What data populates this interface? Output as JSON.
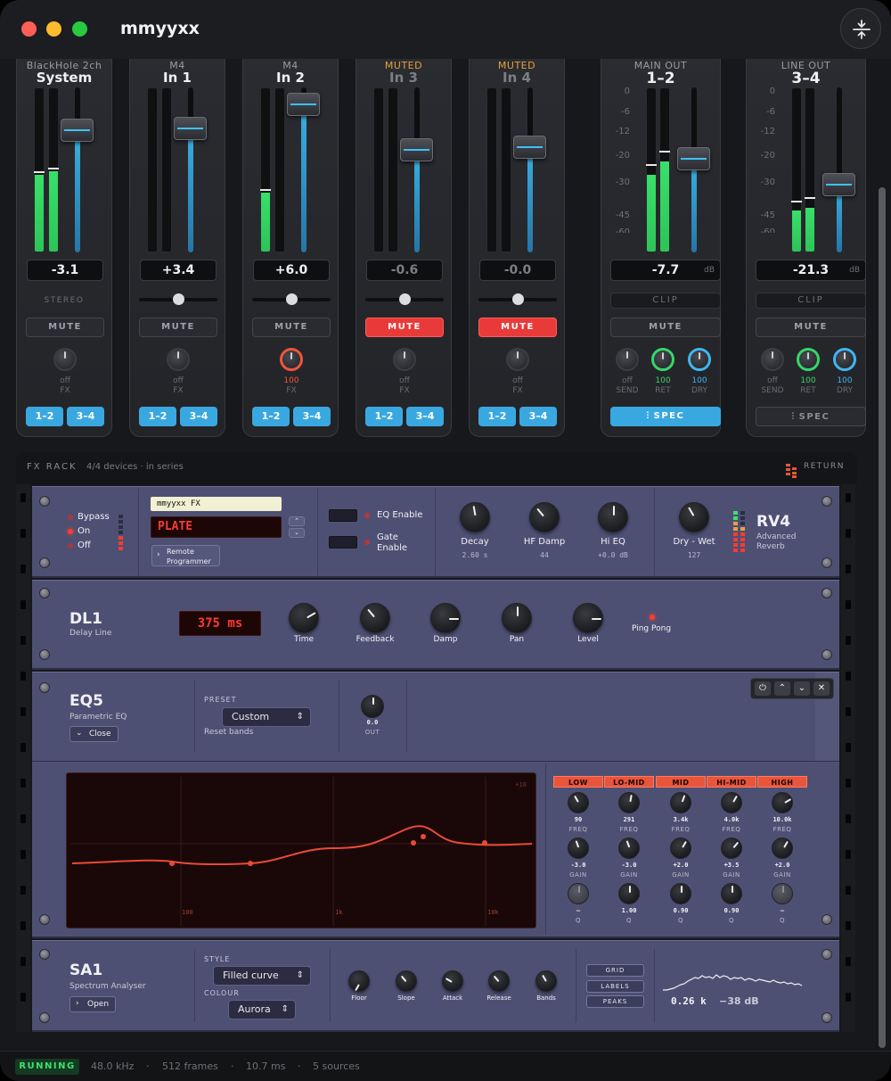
{
  "app": {
    "title": "mmyyxx"
  },
  "colors": {
    "accent": "#3aa8e0",
    "mute_active": "#e93a3a",
    "meter_green": "#36d668",
    "lcd_red": "#ff3b30",
    "rack_panel": "#4e5073"
  },
  "icons": {
    "titlebar_button": "collapse-vertical-icon",
    "fx_rack": "meter-bars-icon",
    "screw": "rack-screw-icon",
    "spec": "waveform-icon"
  },
  "mixer": {
    "strips": [
      {
        "sub": "BlackHole 2ch",
        "name": "System",
        "readout": "-3.1",
        "label": "STEREO",
        "mute": "MUTE",
        "fx_val": "off",
        "fx_lbl": "FX",
        "r1": "1–2",
        "r2": "3–4",
        "meter_left": 0.47,
        "meter_right": 0.49,
        "fader": 0.74,
        "pan": 0.5,
        "muted": false
      },
      {
        "sub": "M4",
        "name": "In 1",
        "readout": "+3.4",
        "mute": "MUTE",
        "fx_val": "off",
        "fx_lbl": "FX",
        "r1": "1–2",
        "r2": "3–4",
        "meter_left": 0,
        "meter_right": 0,
        "fader": 0.75,
        "pan": 0.5,
        "muted": false
      },
      {
        "sub": "M4",
        "name": "In 2",
        "readout": "+6.0",
        "mute": "MUTE",
        "fx_val": "100",
        "fx_lbl": "FX",
        "r1": "1–2",
        "r2": "3–4",
        "meter_left": 0.36,
        "meter_right": 0,
        "fader": 0.9,
        "pan": 0.5,
        "muted": false
      },
      {
        "sub": "MUTED",
        "name": "In 3",
        "readout": "-0.6",
        "mute": "MUTE",
        "fx_val": "off",
        "fx_lbl": "FX",
        "r1": "1–2",
        "r2": "3–4",
        "meter_left": 0,
        "meter_right": 0,
        "fader": 0.62,
        "pan": 0.5,
        "muted": true
      },
      {
        "sub": "MUTED",
        "name": "In 4",
        "readout": "-0.0",
        "mute": "MUTE",
        "fx_val": "off",
        "fx_lbl": "FX",
        "r1": "1–2",
        "r2": "3–4",
        "meter_left": 0,
        "meter_right": 0,
        "fader": 0.64,
        "pan": 0.5,
        "muted": true
      }
    ],
    "outs": [
      {
        "sub": "MAIN OUT",
        "name": "1–2",
        "readout": "-7.7",
        "unit": "dB",
        "clip": "CLIP",
        "mute": "MUTE",
        "send_val": "off",
        "send_lbl": "SEND",
        "ret_val": "100",
        "ret_lbl": "RET",
        "dry_val": "100",
        "dry_lbl": "DRY",
        "spec": "SPEC",
        "meter_left": 0.47,
        "meter_right": 0.55,
        "fader": 0.57,
        "spec_active": true
      },
      {
        "sub": "LINE OUT",
        "name": "3–4",
        "readout": "-21.3",
        "unit": "dB",
        "clip": "CLIP",
        "mute": "MUTE",
        "send_val": "off",
        "send_lbl": "SEND",
        "ret_val": "100",
        "ret_lbl": "RET",
        "dry_val": "100",
        "dry_lbl": "DRY",
        "spec": "SPEC",
        "meter_left": 0.25,
        "meter_right": 0.27,
        "fader": 0.41,
        "spec_active": false
      }
    ],
    "scale_ticks": [
      "0",
      "-6",
      "-12",
      "-20",
      "-30",
      "-45",
      "-60"
    ]
  },
  "rack": {
    "title": "FX RACK",
    "info": "4/4 devices · in series",
    "return": "RETURN",
    "rv4": {
      "bypass": "Bypass",
      "on": "On",
      "off": "Off",
      "preset_name": "mmyyxx FX",
      "preset": "PLATE",
      "remote": "Remote Programmer",
      "eq_enable": "EQ Enable",
      "gate_enable": "Gate Enable",
      "knobs": [
        {
          "label": "Decay",
          "value": "2.60 s"
        },
        {
          "label": "HF Damp",
          "value": "44"
        },
        {
          "label": "Hi EQ",
          "value": "+0.0 dB"
        },
        {
          "label": "Dry - Wet",
          "value": "127"
        }
      ],
      "name": "RV4",
      "sub": "Advanced Reverb"
    },
    "dl1": {
      "name": "DL1",
      "sub": "Delay Line",
      "time": "375 ms",
      "knobs": [
        "Time",
        "Feedback",
        "Damp",
        "Pan",
        "Level"
      ],
      "ping": "Ping Pong"
    },
    "eq5": {
      "name": "EQ5",
      "sub": "Parametric EQ",
      "close": "Close",
      "preset_lbl": "PRESET",
      "preset": "Custom",
      "reset": "Reset bands",
      "out_val": "0.0",
      "out_lbl": "OUT",
      "grid_top": "+18",
      "xticks": [
        "100",
        "1k",
        "10k"
      ],
      "bands": [
        {
          "name": "LOW",
          "freq": "90",
          "gain": "-3.0",
          "q": "–"
        },
        {
          "name": "LO-MID",
          "freq": "291",
          "gain": "-3.0",
          "q": "1.00"
        },
        {
          "name": "MID",
          "freq": "3.4k",
          "gain": "+2.0",
          "q": "0.90"
        },
        {
          "name": "HI-MID",
          "freq": "4.0k",
          "gain": "+3.5",
          "q": "0.90"
        },
        {
          "name": "HIGH",
          "freq": "10.0k",
          "gain": "+2.0",
          "q": "–"
        }
      ],
      "freq_lbl": "FREQ",
      "gain_lbl": "GAIN",
      "q_lbl": "Q"
    },
    "sa1": {
      "name": "SA1",
      "sub": "Spectrum Analyser",
      "open": "Open",
      "style_lbl": "STYLE",
      "style": "Filled curve",
      "colour_lbl": "COLOUR",
      "colour": "Aurora",
      "knobs": [
        "Floor",
        "Slope",
        "Attack",
        "Release",
        "Bands"
      ],
      "toggles": [
        "GRID",
        "LABELS",
        "PEAKS"
      ],
      "freq": "0.26 k",
      "db": "−38 dB"
    }
  },
  "status": {
    "state": "RUNNING",
    "rate": "48.0 kHz",
    "frames": "512 frames",
    "latency": "10.7 ms",
    "sources": "5 sources"
  }
}
